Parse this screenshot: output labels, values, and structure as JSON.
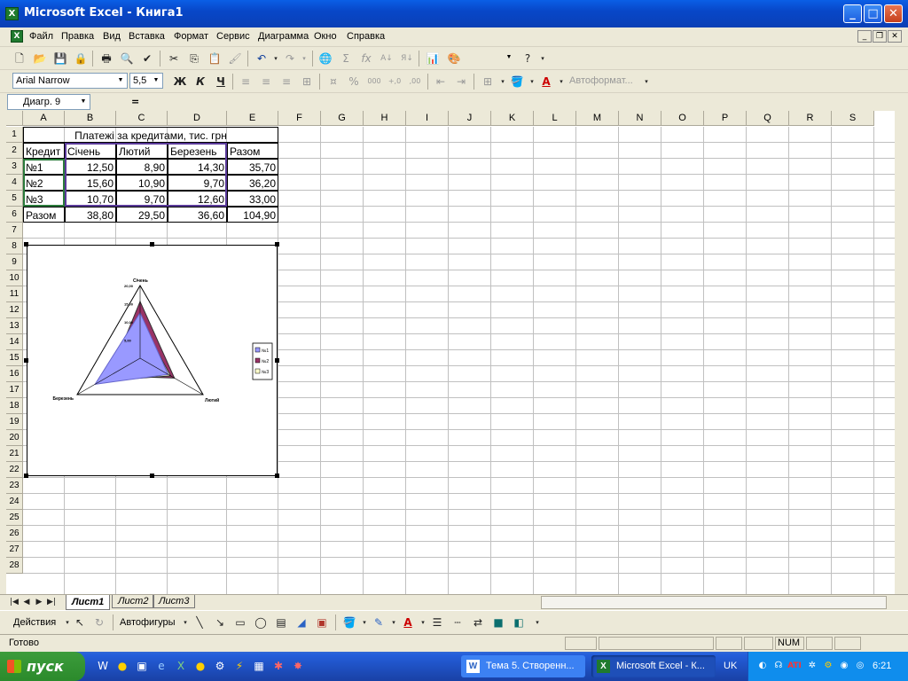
{
  "window": {
    "title": "Microsoft Excel - Книга1",
    "app_icon": "excel-icon"
  },
  "menu": {
    "items": [
      "Файл",
      "Правка",
      "Вид",
      "Вставка",
      "Формат",
      "Сервис",
      "Диаграмма",
      "Окно",
      "Справка"
    ]
  },
  "format_toolbar": {
    "font": "Arial Narrow",
    "size": "5,5",
    "bold": "Ж",
    "italic": "К",
    "underline": "Ч",
    "autoformat": "Автоформат..."
  },
  "formula_bar": {
    "name_box": "Диагр. 9",
    "equals": "="
  },
  "columns": [
    "A",
    "B",
    "C",
    "D",
    "E",
    "F",
    "G",
    "H",
    "I",
    "J",
    "K",
    "L",
    "M",
    "N",
    "O",
    "P",
    "Q",
    "R",
    "S"
  ],
  "rows": [
    "1",
    "2",
    "3",
    "4",
    "5",
    "6",
    "7",
    "8",
    "9",
    "10",
    "11",
    "12",
    "13",
    "14",
    "15",
    "16",
    "17",
    "18",
    "19",
    "20",
    "21",
    "22",
    "23",
    "24",
    "25",
    "26",
    "27",
    "28"
  ],
  "table": {
    "title": "Платежі за кредитами, тис. грн",
    "header": [
      "Кредит",
      "Січень",
      "Лютий",
      "Березень",
      "Разом"
    ],
    "rows": [
      [
        "№1",
        "12,50",
        "8,90",
        "14,30",
        "35,70"
      ],
      [
        "№2",
        "15,60",
        "10,90",
        "9,70",
        "36,20"
      ],
      [
        "№3",
        "10,70",
        "9,70",
        "12,60",
        "33,00"
      ],
      [
        "Разом",
        "38,80",
        "29,50",
        "36,60",
        "104,90"
      ]
    ]
  },
  "chart_data": {
    "type": "radar",
    "categories": [
      "Січень",
      "Лютий",
      "Березень"
    ],
    "series": [
      {
        "name": "№1",
        "values": [
          12.5,
          8.9,
          14.3
        ],
        "color": "#9999ff"
      },
      {
        "name": "№2",
        "values": [
          15.6,
          10.9,
          9.7
        ],
        "color": "#993366"
      },
      {
        "name": "№3",
        "values": [
          10.7,
          9.7,
          12.6
        ],
        "color": "#ffffcc"
      }
    ],
    "ticks": [
      "20,00",
      "15,00",
      "10,00",
      "5,00"
    ],
    "rmax": 20,
    "legend": "right"
  },
  "sheets": [
    "Лист1",
    "Лист2",
    "Лист3"
  ],
  "draw_toolbar": {
    "actions": "Действия",
    "autoshapes": "Автофигуры"
  },
  "status": {
    "ready": "Готово",
    "num": "NUM"
  },
  "taskbar": {
    "start": "пуск",
    "tasks": [
      "Тема 5. Створенн...",
      "Microsoft Excel - К..."
    ],
    "lang": "UK",
    "clock": "6:21"
  }
}
